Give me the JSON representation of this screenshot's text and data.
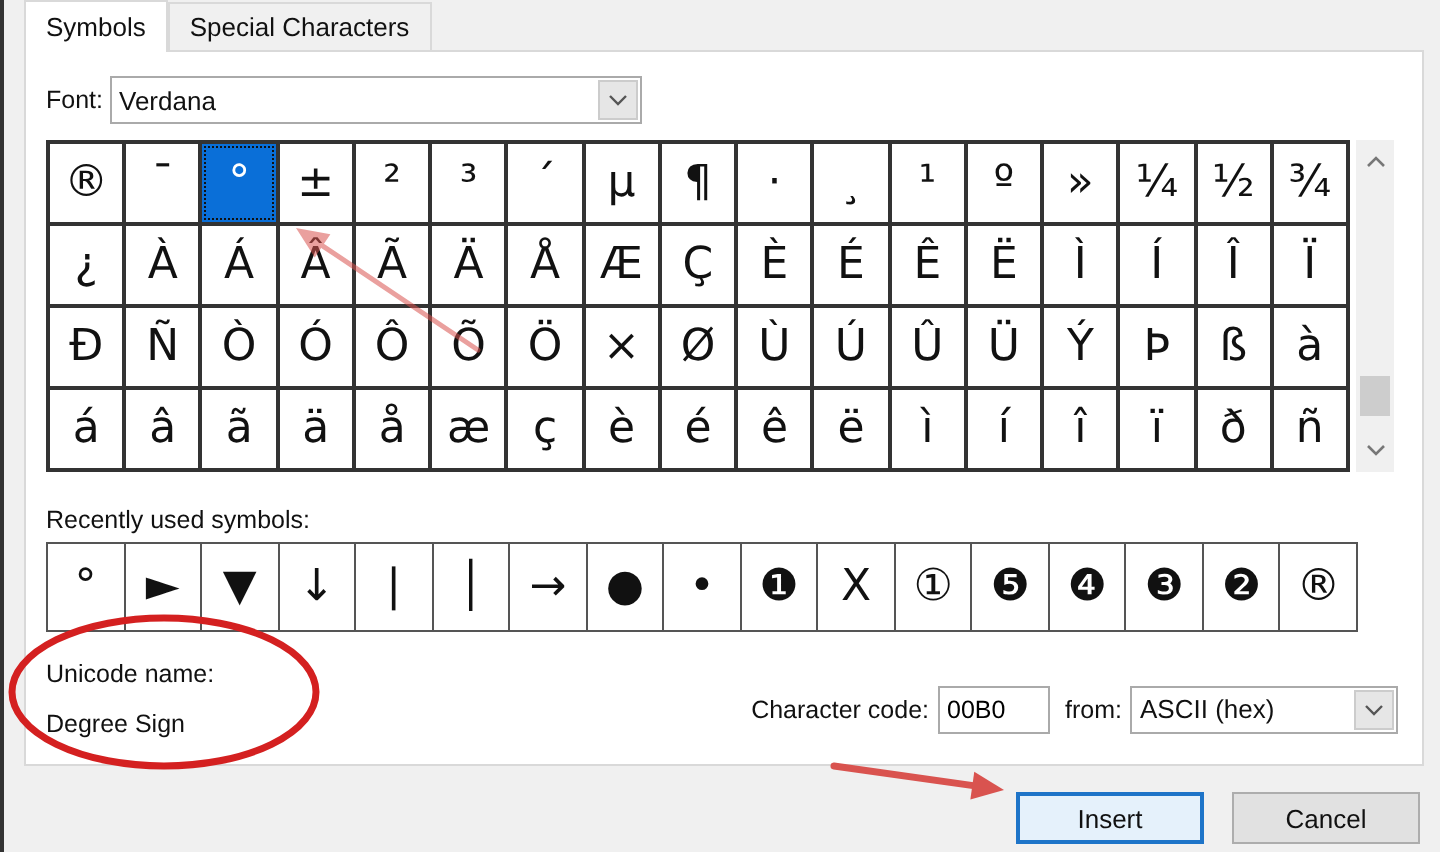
{
  "tabs": [
    {
      "label": "Symbols",
      "selected": true
    },
    {
      "label": "Special Characters",
      "selected": false
    }
  ],
  "font": {
    "label": "Font:",
    "value": "Verdana"
  },
  "symbol_grid": [
    {
      "char": "®",
      "selected": false
    },
    {
      "char": "¯",
      "selected": false
    },
    {
      "char": "°",
      "selected": true
    },
    {
      "char": "±",
      "selected": false
    },
    {
      "char": "²",
      "selected": false
    },
    {
      "char": "³",
      "selected": false
    },
    {
      "char": "´",
      "selected": false
    },
    {
      "char": "µ",
      "selected": false
    },
    {
      "char": "¶",
      "selected": false
    },
    {
      "char": "·",
      "selected": false
    },
    {
      "char": "¸",
      "selected": false
    },
    {
      "char": "¹",
      "selected": false
    },
    {
      "char": "º",
      "selected": false
    },
    {
      "char": "»",
      "selected": false
    },
    {
      "char": "¼",
      "selected": false
    },
    {
      "char": "½",
      "selected": false
    },
    {
      "char": "¾",
      "selected": false
    },
    {
      "char": "¿",
      "selected": false
    },
    {
      "char": "À",
      "selected": false
    },
    {
      "char": "Á",
      "selected": false
    },
    {
      "char": "Â",
      "selected": false
    },
    {
      "char": "Ã",
      "selected": false
    },
    {
      "char": "Ä",
      "selected": false
    },
    {
      "char": "Å",
      "selected": false
    },
    {
      "char": "Æ",
      "selected": false
    },
    {
      "char": "Ç",
      "selected": false
    },
    {
      "char": "È",
      "selected": false
    },
    {
      "char": "É",
      "selected": false
    },
    {
      "char": "Ê",
      "selected": false
    },
    {
      "char": "Ë",
      "selected": false
    },
    {
      "char": "Ì",
      "selected": false
    },
    {
      "char": "Í",
      "selected": false
    },
    {
      "char": "Î",
      "selected": false
    },
    {
      "char": "Ï",
      "selected": false
    },
    {
      "char": "Ð",
      "selected": false
    },
    {
      "char": "Ñ",
      "selected": false
    },
    {
      "char": "Ò",
      "selected": false
    },
    {
      "char": "Ó",
      "selected": false
    },
    {
      "char": "Ô",
      "selected": false
    },
    {
      "char": "Õ",
      "selected": false
    },
    {
      "char": "Ö",
      "selected": false
    },
    {
      "char": "×",
      "selected": false
    },
    {
      "char": "Ø",
      "selected": false
    },
    {
      "char": "Ù",
      "selected": false
    },
    {
      "char": "Ú",
      "selected": false
    },
    {
      "char": "Û",
      "selected": false
    },
    {
      "char": "Ü",
      "selected": false
    },
    {
      "char": "Ý",
      "selected": false
    },
    {
      "char": "Þ",
      "selected": false
    },
    {
      "char": "ß",
      "selected": false
    },
    {
      "char": "à",
      "selected": false
    },
    {
      "char": "á",
      "selected": false
    },
    {
      "char": "â",
      "selected": false
    },
    {
      "char": "ã",
      "selected": false
    },
    {
      "char": "ä",
      "selected": false
    },
    {
      "char": "å",
      "selected": false
    },
    {
      "char": "æ",
      "selected": false
    },
    {
      "char": "ç",
      "selected": false
    },
    {
      "char": "è",
      "selected": false
    },
    {
      "char": "é",
      "selected": false
    },
    {
      "char": "ê",
      "selected": false
    },
    {
      "char": "ë",
      "selected": false
    },
    {
      "char": "ì",
      "selected": false
    },
    {
      "char": "í",
      "selected": false
    },
    {
      "char": "î",
      "selected": false
    },
    {
      "char": "ï",
      "selected": false
    },
    {
      "char": "ð",
      "selected": false
    },
    {
      "char": "ñ",
      "selected": false
    }
  ],
  "recent": {
    "label": "Recently used symbols:",
    "symbols": [
      "°",
      "►",
      "▼",
      "↓",
      "|",
      "│",
      "→",
      "●",
      "•",
      "❶",
      "X",
      "①",
      "❺",
      "❹",
      "❸",
      "❷",
      "®"
    ]
  },
  "unicode_name": {
    "label": "Unicode name:",
    "value": "Degree Sign"
  },
  "character_code": {
    "label": "Character code:",
    "value": "00B0"
  },
  "from": {
    "label": "from:",
    "value": "ASCII (hex)"
  },
  "buttons": [
    {
      "label": "Insert",
      "kind": "default"
    },
    {
      "label": "Cancel",
      "kind": "normal"
    }
  ],
  "annotations": [
    {
      "kind": "arrow"
    },
    {
      "kind": "ellipse"
    },
    {
      "kind": "arrow"
    }
  ]
}
